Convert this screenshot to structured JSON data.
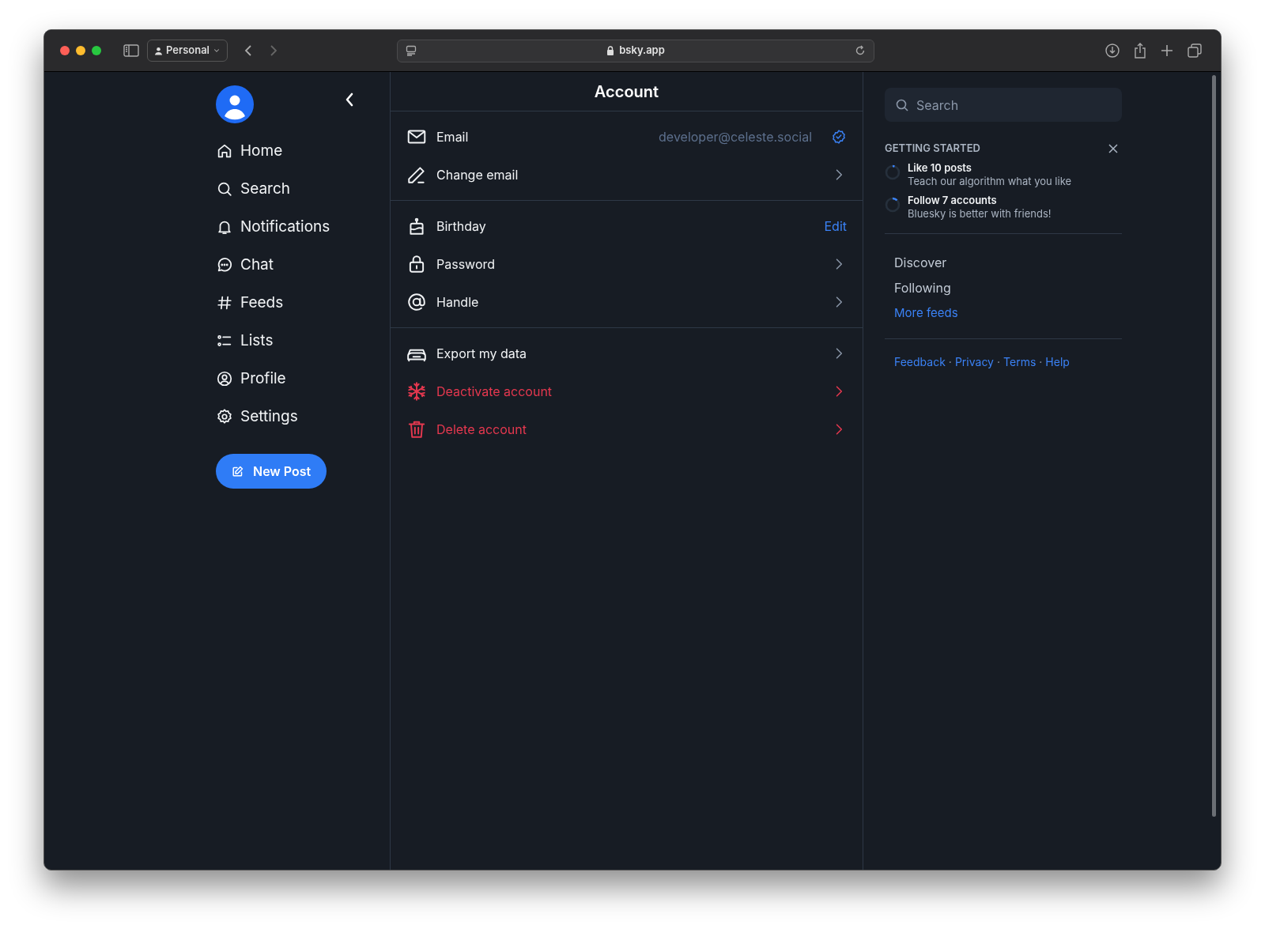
{
  "browser": {
    "profile": "Personal",
    "url": "bsky.app"
  },
  "sidebar": {
    "nav": [
      {
        "label": "Home"
      },
      {
        "label": "Search"
      },
      {
        "label": "Notifications"
      },
      {
        "label": "Chat"
      },
      {
        "label": "Feeds"
      },
      {
        "label": "Lists"
      },
      {
        "label": "Profile"
      },
      {
        "label": "Settings"
      }
    ],
    "new_post": "New Post"
  },
  "page": {
    "title": "Account",
    "sections": [
      [
        {
          "label": "Email",
          "kind": "value",
          "value": "developer@celeste.social",
          "verified": true,
          "danger": false
        },
        {
          "label": "Change email",
          "kind": "chevron",
          "danger": false
        }
      ],
      [
        {
          "label": "Birthday",
          "kind": "edit",
          "action_label": "Edit",
          "danger": false
        },
        {
          "label": "Password",
          "kind": "chevron",
          "danger": false
        },
        {
          "label": "Handle",
          "kind": "chevron",
          "danger": false
        }
      ],
      [
        {
          "label": "Export my data",
          "kind": "chevron",
          "danger": false
        },
        {
          "label": "Deactivate account",
          "kind": "chevron",
          "danger": true
        },
        {
          "label": "Delete account",
          "kind": "chevron",
          "danger": true
        }
      ]
    ]
  },
  "right": {
    "search": {
      "placeholder": "Search"
    },
    "getting_started": {
      "title": "GETTING STARTED",
      "tasks": [
        {
          "title": "Like 10 posts",
          "subtitle": "Teach our algorithm what you like",
          "level": 0.05
        },
        {
          "title": "Follow 7 accounts",
          "subtitle": "Bluesky is better with friends!",
          "level": 0.12
        }
      ]
    },
    "feeds": [
      {
        "label": "Discover",
        "kind": "feed"
      },
      {
        "label": "Following",
        "kind": "feed"
      },
      {
        "label": "More feeds",
        "kind": "link"
      }
    ],
    "footer": [
      {
        "label": "Feedback",
        "kind": "link"
      },
      {
        "label": "·",
        "kind": "separator"
      },
      {
        "label": "Privacy",
        "kind": "link"
      },
      {
        "label": "·",
        "kind": "separator"
      },
      {
        "label": "Terms",
        "kind": "link"
      },
      {
        "label": "·",
        "kind": "separator"
      },
      {
        "label": "Help",
        "kind": "link"
      }
    ]
  }
}
